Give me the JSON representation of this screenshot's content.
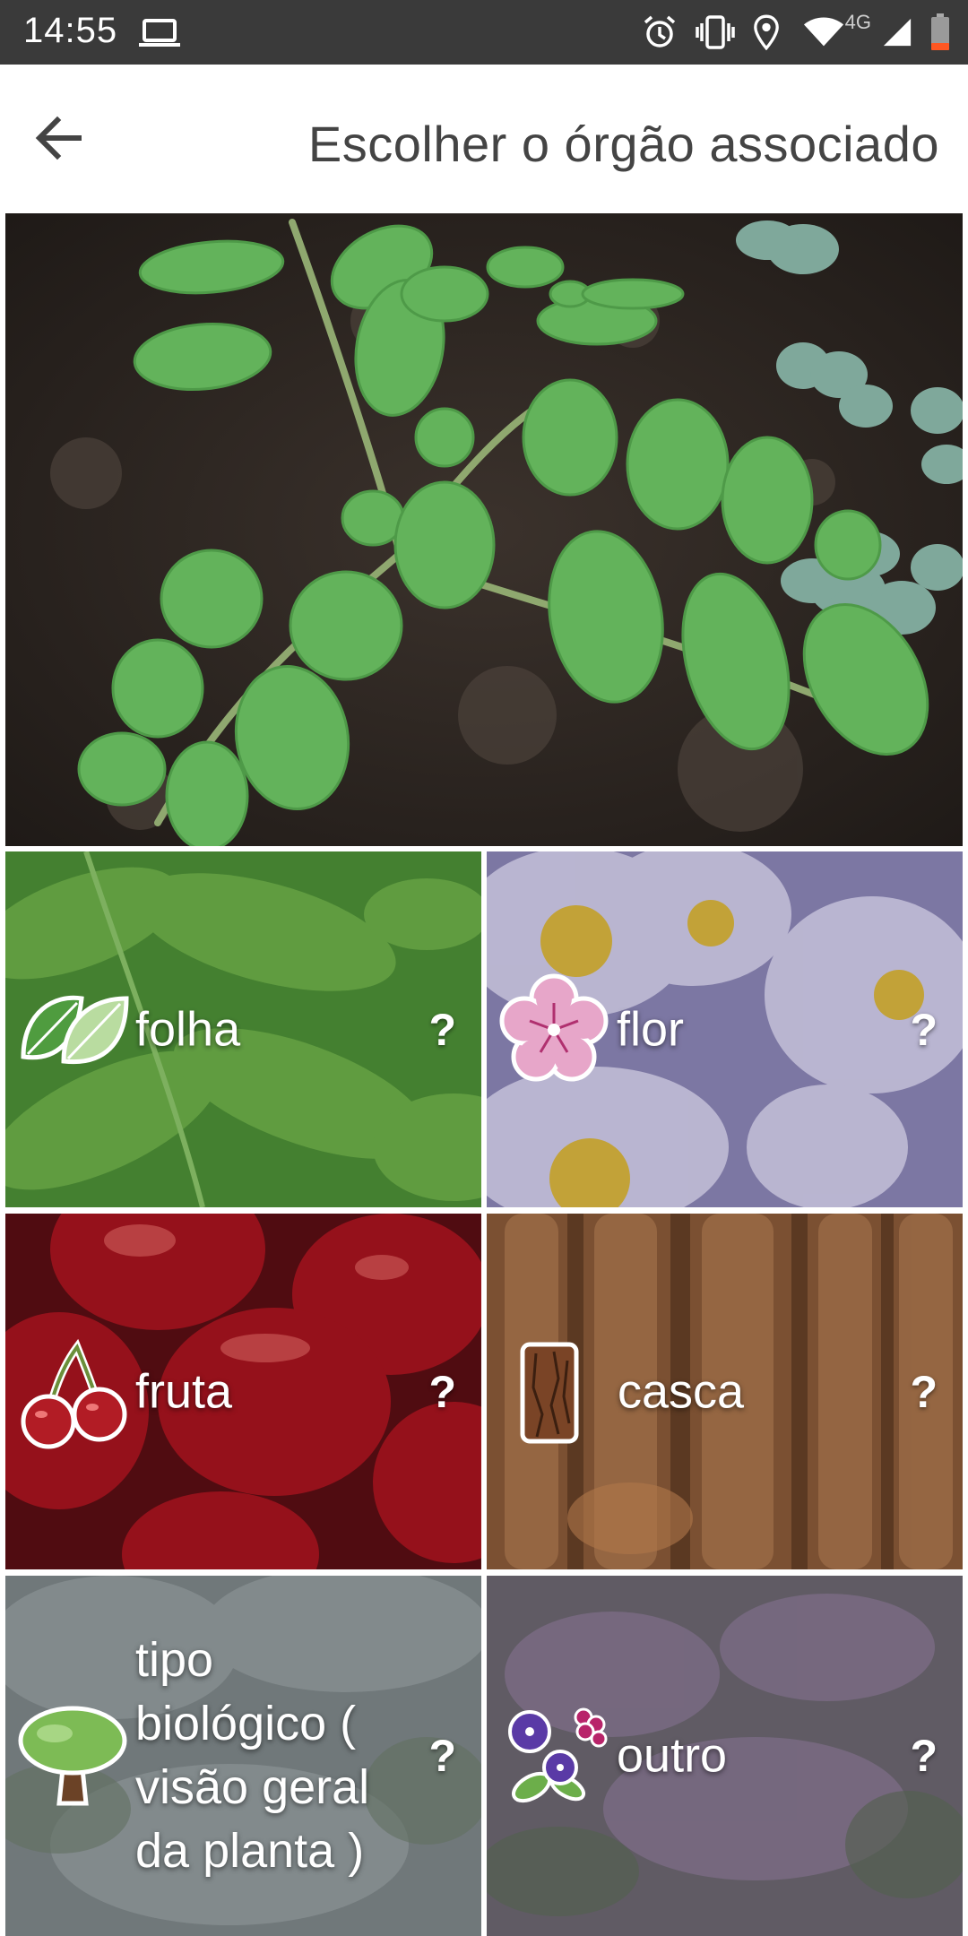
{
  "status_bar": {
    "time": "14:55",
    "network": "4G",
    "icons": [
      "laptop-icon",
      "alarm-icon",
      "vibrate-icon",
      "location-icon",
      "wifi-icon",
      "signal-icon",
      "battery-low-icon"
    ],
    "battery_accent": "#ff5722"
  },
  "app_bar": {
    "back_icon": "arrow-left-icon",
    "title": "Escolher o órgão associado"
  },
  "photo": {
    "subject": "plant-photo"
  },
  "organs": [
    {
      "id": "leaf",
      "label": "folha",
      "icon": "leaf-icon",
      "help": "?"
    },
    {
      "id": "flower",
      "label": "flor",
      "icon": "flower-icon",
      "help": "?"
    },
    {
      "id": "fruit",
      "label": "fruta",
      "icon": "cherry-icon",
      "help": "?"
    },
    {
      "id": "bark",
      "label": "casca",
      "icon": "bark-icon",
      "help": "?"
    },
    {
      "id": "habit",
      "label": "tipo biológico ( visão geral da planta )",
      "icon": "tree-icon",
      "help": "?"
    },
    {
      "id": "other",
      "label": "outro",
      "icon": "flowers-icon",
      "help": "?"
    }
  ],
  "colors": {
    "status_bar": "#3a3a3a",
    "title_text": "#444444",
    "leaf_green": "#5cb85c"
  }
}
